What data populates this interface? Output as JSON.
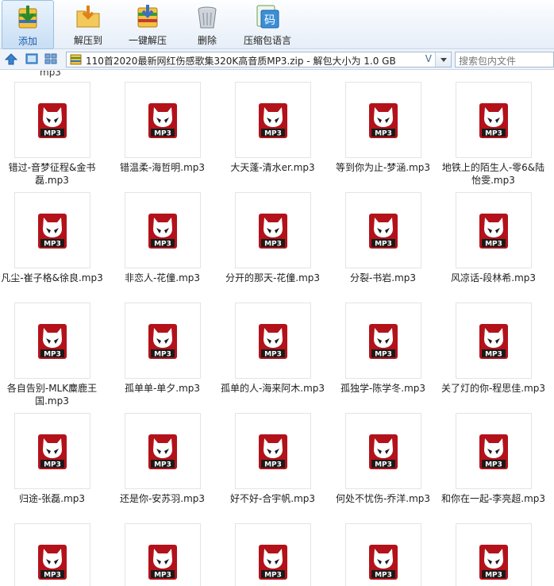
{
  "toolbar": {
    "add": "添加",
    "extract_to": "解压到",
    "one_click_extract": "一键解压",
    "delete": "删除",
    "archive_language": "压缩包语言",
    "language_icon_glyph": "码"
  },
  "address_bar": {
    "path": "110首2020最新网红伤感歌集320K高音质MP3.zip - 解包大小为 1.0 GB",
    "dropdown_glyph": "V",
    "search_placeholder": "搜索包内文件"
  },
  "file_list": {
    "partial_label_above": "mp3",
    "icon_badge_text": "MP3",
    "colors": {
      "icon_red": "#b3121a",
      "icon_dark": "#1a1a1a",
      "accent_blue": "#1f5fa8"
    },
    "rows": [
      [
        "错过-音梦征程&金书磊.mp3",
        "错温柔-海哲明.mp3",
        "大天蓬-清水er.mp3",
        "等到你为止-梦涵.mp3",
        "地铁上的陌生人-零6&陆怡雯.mp3"
      ],
      [
        "凡尘-崔子格&徐良.mp3",
        "非恋人-花僮.mp3",
        "分开的那天-花僮.mp3",
        "分裂-书岩.mp3",
        "风凉话-段林希.mp3"
      ],
      [
        "各自告别-MLK麋鹿王国.mp3",
        "孤单单-单夕.mp3",
        "孤单的人-海来阿木.mp3",
        "孤独学-陈学冬.mp3",
        "关了灯的你-程思佳.mp3"
      ],
      [
        "归途-张磊.mp3",
        "还是你-安苏羽.mp3",
        "好不好-合宇帆.mp3",
        "何处不忧伤-乔洋.mp3",
        "和你在一起-李亮超.mp3"
      ],
      [
        "",
        "",
        "",
        "",
        ""
      ]
    ]
  }
}
